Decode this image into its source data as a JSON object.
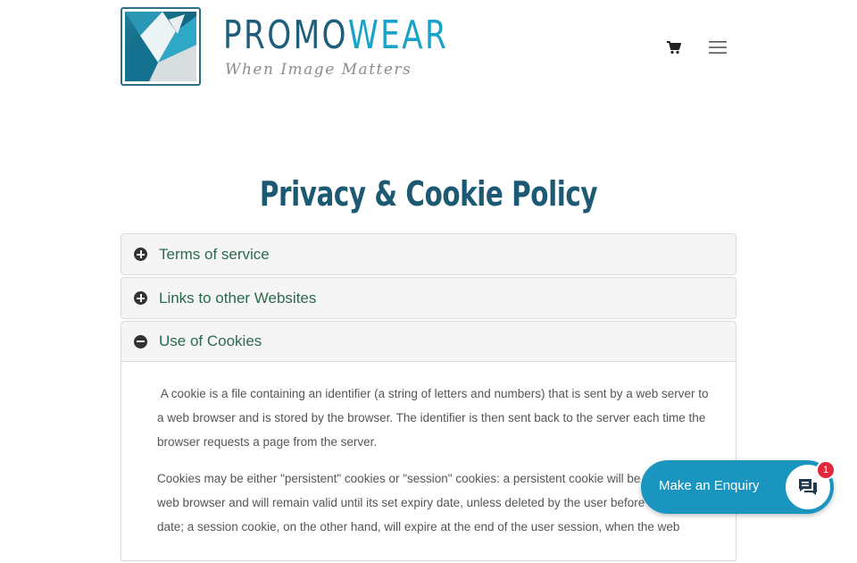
{
  "header": {
    "brand_part1": "PROMO",
    "brand_part2": "WEAR",
    "tagline": "When Image Matters",
    "logo_icon": "promowear-logo",
    "cart_icon": "shopping-cart-icon",
    "menu_icon": "hamburger-menu-icon"
  },
  "page": {
    "title": "Privacy & Cookie Policy"
  },
  "accordion": {
    "items": [
      {
        "label": "Terms of service",
        "state": "collapsed",
        "icon": "plus-circle-icon"
      },
      {
        "label": "Links to other Websites",
        "state": "collapsed",
        "icon": "plus-circle-icon"
      },
      {
        "label": "Use of Cookies",
        "state": "expanded",
        "icon": "minus-circle-icon",
        "paragraphs": [
          " A cookie is a file containing an identifier (a string of letters and numbers) that is sent by a web server to a web browser and is stored by the browser. The identifier is then sent back to the server each time the browser requests a page from the server.",
          "Cookies may be either \"persistent\" cookies or \"session\" cookies: a persistent cookie will be stored by a web browser and will remain valid until its set expiry date, unless deleted by the user before the expiry date; a session cookie, on the other hand, will expire at the end of the user session, when the web"
        ]
      }
    ]
  },
  "enquiry": {
    "label": "Make an Enquiry",
    "badge_count": "1",
    "icon": "chat-icon"
  },
  "colors": {
    "brand_dark": "#1f5e7a",
    "brand_light": "#1aa3c8",
    "title": "#1c5a74",
    "accordion_label": "#2a6a4e",
    "enquiry_button": "#1a95c0",
    "badge": "#e0283f"
  }
}
